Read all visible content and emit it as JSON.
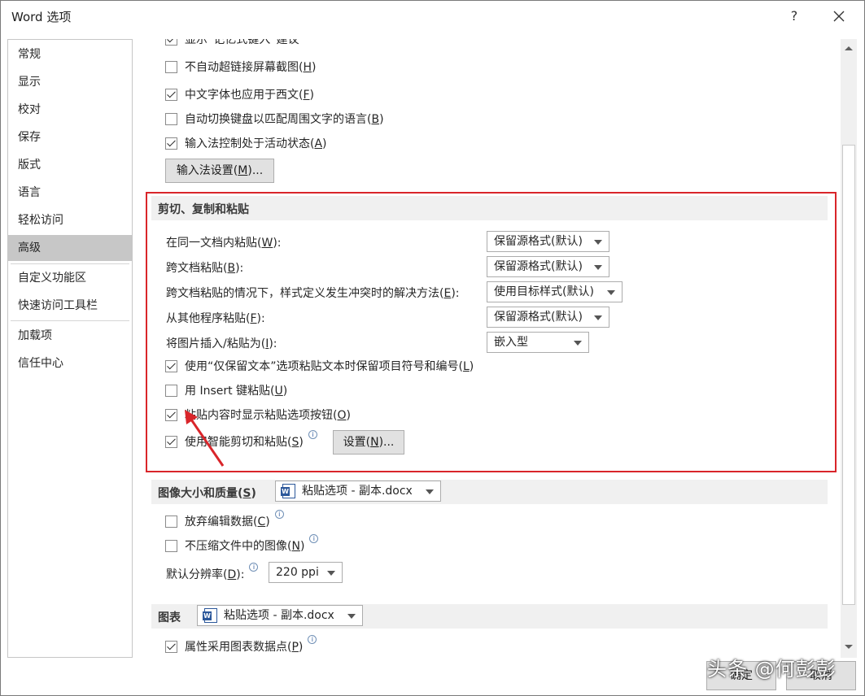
{
  "window": {
    "title": "Word 选项",
    "help_label": "?"
  },
  "nav": {
    "items": [
      {
        "label": "常规"
      },
      {
        "label": "显示"
      },
      {
        "label": "校对"
      },
      {
        "label": "保存"
      },
      {
        "label": "版式"
      },
      {
        "label": "语言"
      },
      {
        "label": "轻松访问"
      },
      {
        "label": "高级",
        "selected": true
      },
      {
        "label": "自定义功能区"
      },
      {
        "label": "快速访问工具栏"
      },
      {
        "label": "加载项"
      },
      {
        "label": "信任中心"
      }
    ]
  },
  "options_top": {
    "partial_label": "显示“记忆式键入”建议",
    "items": [
      {
        "label": "不自动超链接屏幕截图(",
        "key": "H",
        "checked": false
      },
      {
        "label": "中文字体也应用于西文(",
        "key": "F",
        "checked": true
      },
      {
        "label": "自动切换键盘以匹配周围文字的语言(",
        "key": "B",
        "checked": false
      },
      {
        "label": "输入法控制处于活动状态(",
        "key": "A",
        "checked": true
      }
    ],
    "ime_button": {
      "label": "输入法设置(",
      "key": "M",
      "suffix": ")..."
    }
  },
  "cut_copy_paste": {
    "title": "剪切、复制和粘贴",
    "rows": [
      {
        "label": "在同一文档内粘贴(",
        "key": "W",
        "suffix": "):",
        "value": "保留源格式(默认)"
      },
      {
        "label": "跨文档粘贴(",
        "key": "B",
        "suffix": "):",
        "value": "保留源格式(默认)"
      },
      {
        "label": "跨文档粘贴的情况下，样式定义发生冲突时的解决方法(",
        "key": "E",
        "suffix": "):",
        "value": "使用目标样式(默认)"
      },
      {
        "label": "从其他程序粘贴(",
        "key": "F",
        "suffix": "):",
        "value": "保留源格式(默认)"
      },
      {
        "label": "将图片插入/粘贴为(",
        "key": "I",
        "suffix": "):",
        "value": "嵌入型"
      }
    ],
    "checks": [
      {
        "label": "使用“仅保留文本”选项粘贴文本时保留项目符号和编号(",
        "key": "L",
        "checked": true
      },
      {
        "label": "用 Insert 键粘贴(",
        "key": "U",
        "checked": false
      },
      {
        "label": "粘贴内容时显示粘贴选项按钮(",
        "key": "O",
        "checked": true
      },
      {
        "label": "使用智能剪切和粘贴(",
        "key": "S",
        "checked": true
      }
    ],
    "settings_button": {
      "label": "设置(",
      "key": "N",
      "suffix": ")..."
    }
  },
  "image_quality": {
    "title": "图像大小和质量(",
    "key": "S",
    "doc": "粘贴选项 - 副本.docx",
    "checks": [
      {
        "label": "放弃编辑数据(",
        "key": "C",
        "checked": false
      },
      {
        "label": "不压缩文件中的图像(",
        "key": "N",
        "checked": false
      }
    ],
    "resolution_label": "默认分辨率(",
    "resolution_key": "D",
    "resolution_value": "220 ppi"
  },
  "charts": {
    "title": "图表",
    "doc": "粘贴选项 - 副本.docx",
    "checks": [
      {
        "label": "属性采用图表数据点(",
        "key": "P",
        "checked": true
      }
    ]
  },
  "footer": {
    "ok": "确定",
    "cancel": "取消"
  },
  "watermark": "头条 @何彭彭",
  "colors": {
    "highlight": "#d9252a",
    "selected_nav": "#c7c7c7",
    "accent": "#2b579a"
  }
}
